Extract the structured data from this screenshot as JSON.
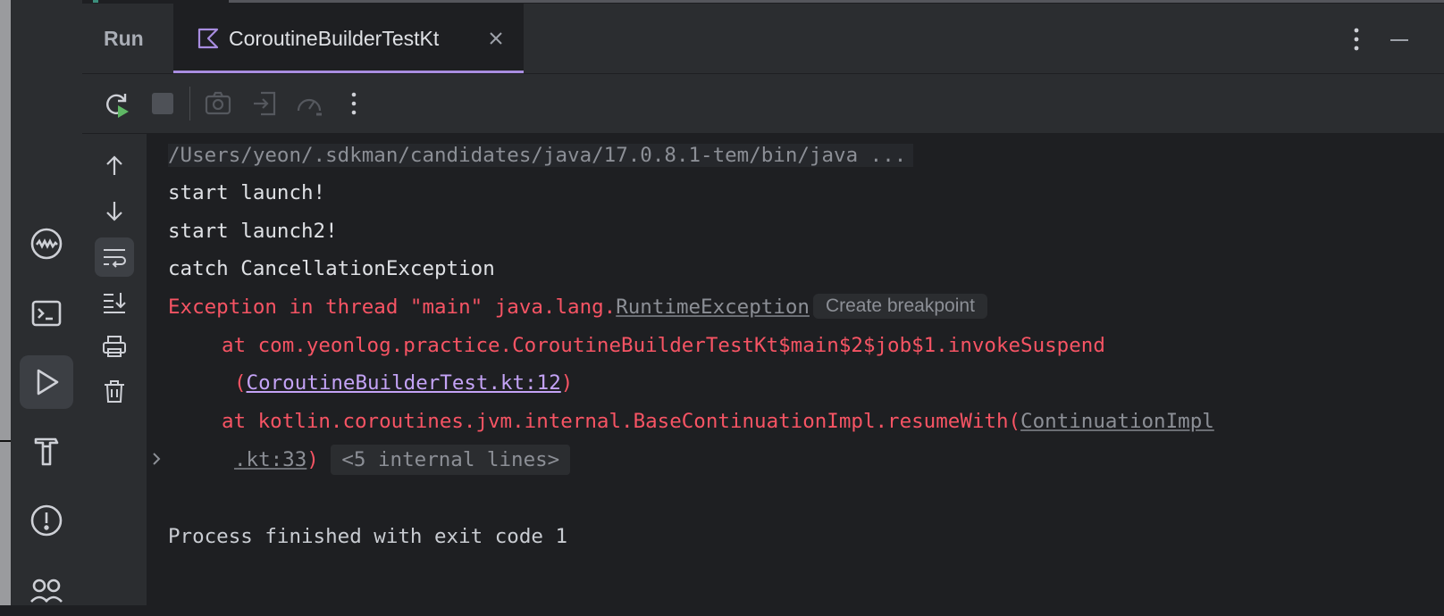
{
  "window": {
    "run_label": "Run",
    "tab_title": "CoroutineBuilderTestKt"
  },
  "toolstrip": {
    "icons": [
      "profiler-icon",
      "terminal-icon",
      "run-icon",
      "build-icon",
      "problems-icon",
      "services-icon"
    ],
    "active": "run-icon"
  },
  "toolbar": {
    "icons": [
      "rerun-icon",
      "stop-icon",
      "screenshot-icon",
      "exit-icon",
      "profile-icon",
      "more-icon"
    ]
  },
  "console": {
    "sidebar_icons": [
      "arrow-up-icon",
      "arrow-down-icon",
      "soft-wrap-icon",
      "scroll-to-end-icon",
      "print-icon",
      "trash-icon"
    ],
    "command": "/Users/yeon/.sdkman/candidates/java/17.0.8.1-tem/bin/java ...",
    "out1": "start launch!",
    "out2": "start launch2!",
    "out3": "catch CancellationException",
    "err_prefix": "Exception in thread \"main\" java.lang.",
    "err_exception": "RuntimeException",
    "breakpoint_hint": "Create breakpoint",
    "trace1": "at com.yeonlog.practice.CoroutineBuilderTestKt$main$2$job$1.invokeSuspend",
    "trace1_open": "(",
    "trace1_link": "CoroutineBuilderTest.kt:12",
    "trace1_close": ")",
    "trace2": "at kotlin.coroutines.jvm.internal.BaseContinuationImpl.resumeWith(",
    "trace2_link_a": "ContinuationImpl",
    "trace2_link_b": ".kt:33",
    "trace2_close": ")",
    "internal_lines": "<5 internal lines>",
    "finished": "Process finished with exit code 1"
  },
  "colors": {
    "background": "#1e1f22",
    "panel": "#2b2d30",
    "error": "#f75464",
    "link": "#c4a3f6",
    "accent": "#a88de0"
  }
}
